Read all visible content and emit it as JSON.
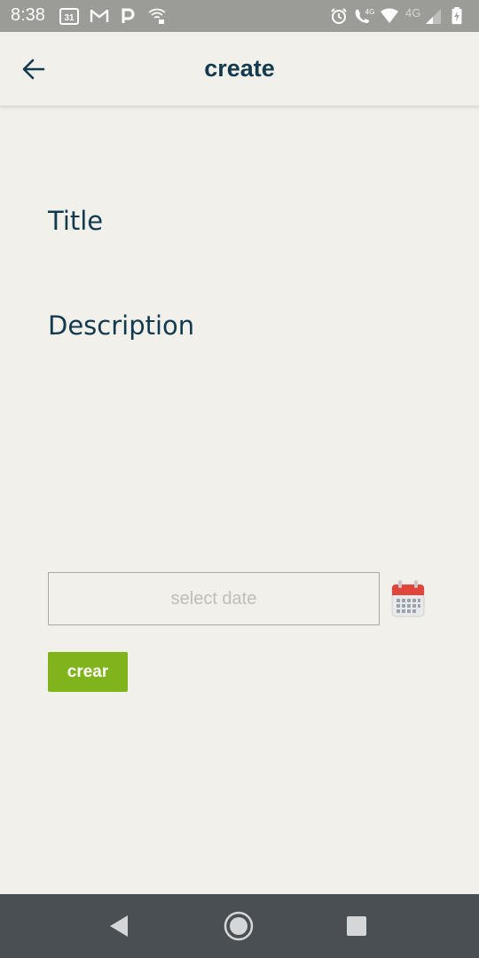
{
  "status_bar": {
    "time": "8:38",
    "calendar_day": "31",
    "network_label": "4G",
    "call_label": "4G",
    "left_icons": [
      "calendar-icon",
      "gmail-icon",
      "parking-icon",
      "wifi-hotspot-icon"
    ],
    "right_icons": [
      "alarm-icon",
      "wifi-call-icon",
      "wifi-icon",
      "signal-icon",
      "battery-icon"
    ]
  },
  "app_bar": {
    "title": "create",
    "back_icon": "back-arrow-icon"
  },
  "form": {
    "title_label": "Title",
    "description_label": "Description",
    "date_placeholder": "select date",
    "date_value": "",
    "calendar_icon": "calendar-icon",
    "submit_label": "crear",
    "submit_color": "#7fb51b"
  },
  "nav_bar": {
    "buttons": [
      "back-triangle-icon",
      "home-circle-icon",
      "recents-square-icon"
    ]
  },
  "colors": {
    "background": "#f1f0ea",
    "primary_text": "#123a4f",
    "accent": "#7fb51b",
    "status_bar": "#9b9b98",
    "nav_bar": "#4a4f54"
  }
}
